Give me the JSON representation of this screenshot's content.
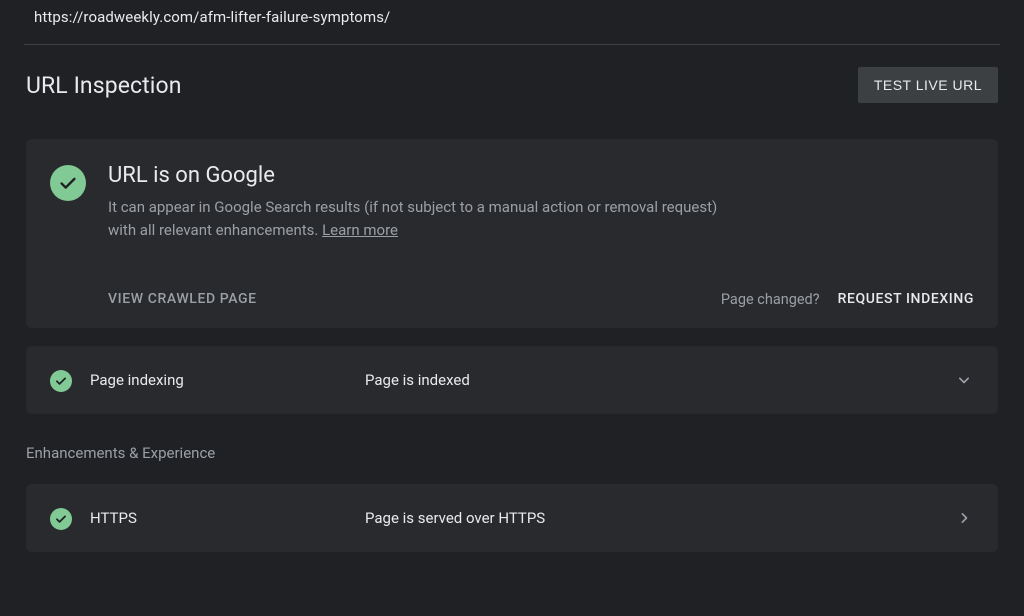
{
  "url": "https://roadweekly.com/afm-lifter-failure-symptoms/",
  "header": {
    "title": "URL Inspection",
    "test_live_label": "TEST LIVE URL"
  },
  "status_card": {
    "title": "URL is on Google",
    "description_pre": "It can appear in Google Search results (if not subject to a manual action or removal request) with all relevant enhancements. ",
    "learn_more": "Learn more",
    "view_crawled_label": "VIEW CRAWLED PAGE",
    "page_changed_label": "Page changed?",
    "request_indexing_label": "REQUEST INDEXING"
  },
  "rows": {
    "indexing": {
      "label": "Page indexing",
      "value": "Page is indexed"
    },
    "https": {
      "label": "HTTPS",
      "value": "Page is served over HTTPS"
    }
  },
  "section_label": "Enhancements & Experience"
}
